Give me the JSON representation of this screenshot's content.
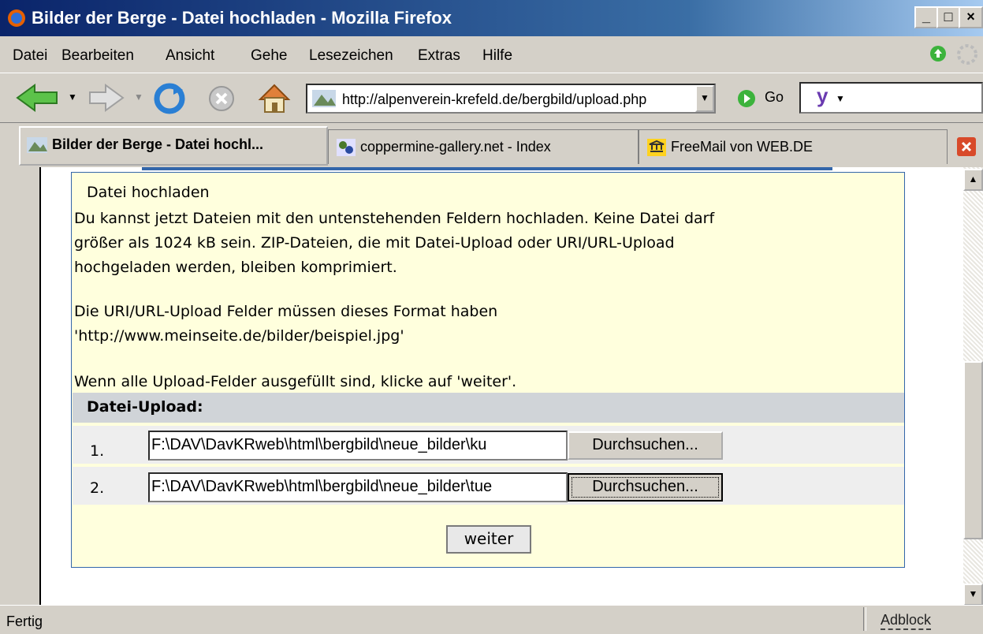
{
  "window": {
    "title": "Bilder der Berge - Datei hochladen - Mozilla Firefox",
    "buttons": [
      "_",
      "□",
      "×"
    ]
  },
  "menu": {
    "items": [
      "Datei",
      "Bearbeiten",
      "Ansicht",
      "Gehe",
      "Lesezeichen",
      "Extras",
      "Hilfe"
    ]
  },
  "toolbar": {
    "url": "http://alpenverein-krefeld.de/bergbild/upload.php",
    "go_label": "Go",
    "search_value": "y"
  },
  "tabs": [
    {
      "label": "Bilder der Berge - Datei hochl...",
      "active": true
    },
    {
      "label": "coppermine-gallery.net - Index",
      "active": false
    },
    {
      "label": "FreeMail von WEB.DE",
      "active": false
    }
  ],
  "page": {
    "heading": "Datei hochladen",
    "intro_lines": [
      "Du kannst jetzt Dateien mit den untenstehenden Feldern hochladen. Keine Datei darf",
      "größer als 1024 kB sein. ZIP-Dateien, die mit Datei-Upload oder URI/URL-Upload",
      "hochgeladen werden, bleiben komprimiert."
    ],
    "url_lines": [
      "Die URI/URL-Upload Felder müssen dieses Format haben",
      "'http://www.meinseite.de/bilder/beispiel.jpg'"
    ],
    "instruction": "Wenn alle Upload-Felder ausgefüllt sind, klicke auf 'weiter'.",
    "upload_header": "Datei-Upload:",
    "rows": [
      {
        "num": "1.",
        "value": "F:\\DAV\\DavKRweb\\html\\bergbild\\neue_bilder\\ku",
        "button": "Durchsuchen..."
      },
      {
        "num": "2.",
        "value": "F:\\DAV\\DavKRweb\\html\\bergbild\\neue_bilder\\tue",
        "button": "Durchsuchen..."
      }
    ],
    "submit_label": "weiter"
  },
  "status": {
    "text": "Fertig",
    "adblock": "Adblock"
  }
}
